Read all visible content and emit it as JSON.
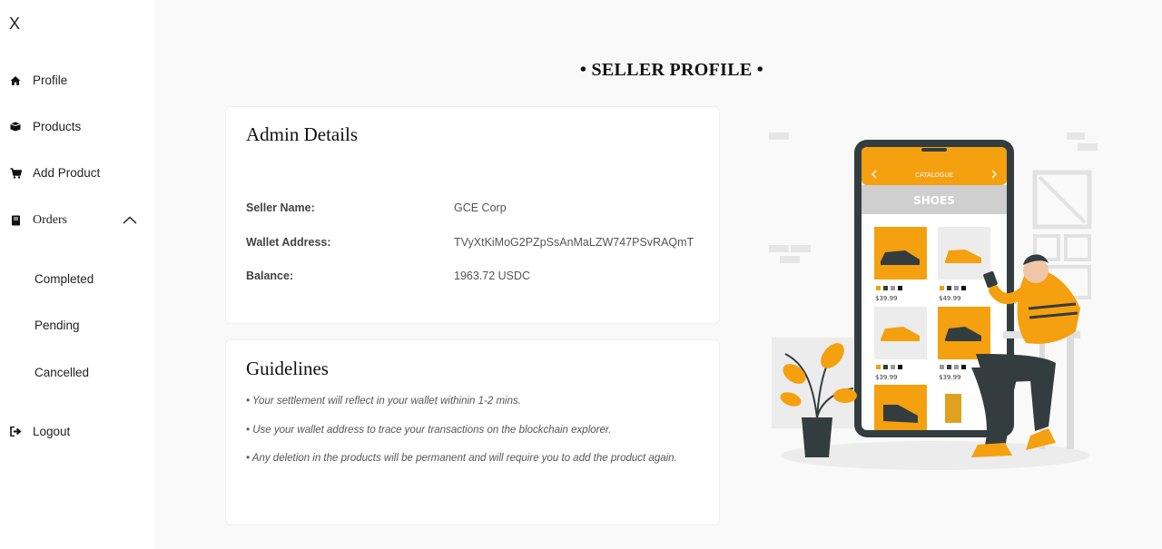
{
  "sidebar": {
    "close_label": "X",
    "items": [
      {
        "label": "Profile",
        "icon": "home-icon"
      },
      {
        "label": "Products",
        "icon": "box-icon"
      },
      {
        "label": "Add Product",
        "icon": "cart-icon"
      }
    ],
    "orders": {
      "label": "Orders",
      "icon": "book-icon",
      "children": [
        "Completed",
        "Pending",
        "Cancelled"
      ]
    },
    "logout": {
      "label": "Logout",
      "icon": "logout-icon"
    }
  },
  "page": {
    "title": "• SELLER PROFILE •"
  },
  "admin": {
    "title": "Admin Details",
    "seller_name_label": "Seller Name:",
    "seller_name": "GCE Corp",
    "wallet_label": "Wallet Address:",
    "wallet": "TVyXtKiMoG2PZpSsAnMaLZW747PSvRAQmT",
    "balance_label": "Balance:",
    "balance": "1963.72 USDC"
  },
  "guidelines": {
    "title": "Guidelines",
    "items": [
      "• Your settlement will reflect in your wallet withinin 1-2 mins.",
      "• Use your wallet address to trace your transactions on the blockchain explorer.",
      "• Any deletion in the products will be permanent and will require you to add the product again."
    ]
  },
  "illustration": {
    "header": "CATALOGUE",
    "category": "SHOES",
    "prices": [
      "$39.99",
      "$49.99",
      "$39.99",
      "$39.99"
    ],
    "accent": "#f5a00f"
  }
}
